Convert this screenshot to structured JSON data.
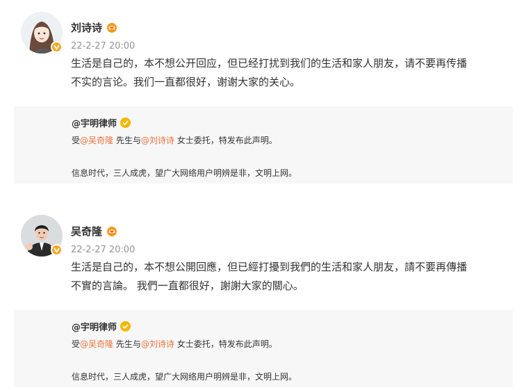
{
  "posts": [
    {
      "author": "刘诗诗",
      "time": "22-2-27 20:00",
      "text_line1": "生活是自己的，本不想公开回应，但已经打扰到我们的生活和家人朋友，请不要再传播",
      "text_line2": "不实的言论。我们一直都很好，谢谢大家的关心。",
      "repost": {
        "author": "@宇明律师",
        "line1_prefix": "受",
        "mention1": "@吴奇隆",
        "line1_mid": " 先生与",
        "mention2": "@刘诗诗",
        "line1_suffix": " 女士委托，特发布此声明。",
        "line2": "信息时代，三人成虎，望广大网络用户明辨是非，文明上网。"
      }
    },
    {
      "author": "吴奇隆",
      "time": "22-2-27 20:00",
      "text_line1": "生活是自己的，本不想公開回應，但已經打擾到我們的生活和家人朋友，請不要再傳播",
      "text_line2": "不實的言論。 我們一直都很好，謝謝大家的關心。",
      "repost": {
        "author": "@宇明律师",
        "line1_prefix": "受",
        "mention1": "@吴奇隆",
        "line1_mid": " 先生与",
        "mention2": "@刘诗诗",
        "line1_suffix": " 女士委托，特发布此声明。",
        "line2": "信息时代，三人成虎，望广大网络用户明辨是非，文明上网。"
      }
    }
  ],
  "icons": {
    "crown": "vip-crown-icon",
    "verified": "verified-badge-icon"
  },
  "colors": {
    "mention": "#eb7340",
    "timestamp": "#939393",
    "repost_bg": "#f7f7f7",
    "verified": "#f5b700"
  }
}
